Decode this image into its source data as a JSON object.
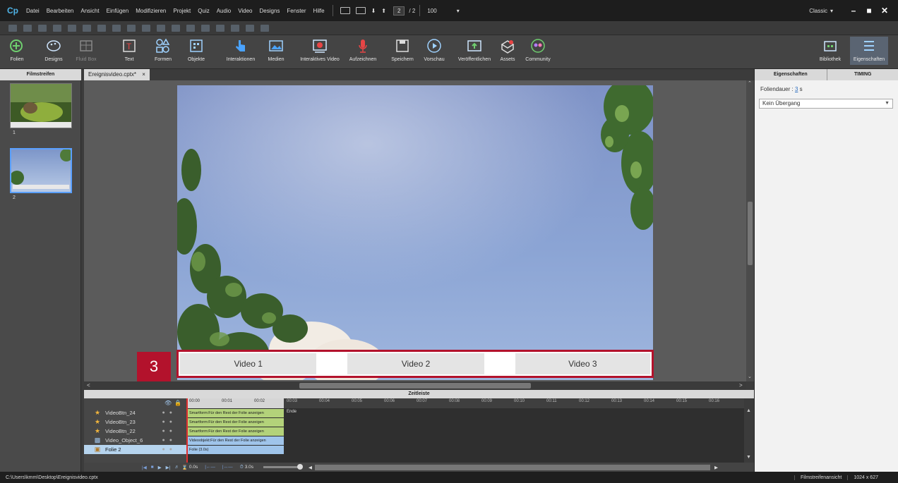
{
  "app": {
    "logo": "Cp",
    "workspace": "Classic"
  },
  "menu": [
    "Datei",
    "Bearbeiten",
    "Ansicht",
    "Einfügen",
    "Modifizieren",
    "Projekt",
    "Quiz",
    "Audio",
    "Video",
    "Designs",
    "Fenster",
    "Hilfe"
  ],
  "nav": {
    "current_page": "2",
    "total_pages": "/ 2",
    "zoom": "100"
  },
  "toolbar": {
    "tools": [
      {
        "label": "Folien",
        "icon": "plus-circle-icon"
      },
      {
        "label": "Designs",
        "icon": "palette-icon"
      },
      {
        "label": "Fluid Box",
        "icon": "fluid-box-icon"
      },
      {
        "label": "Text",
        "icon": "text-icon"
      },
      {
        "label": "Formen",
        "icon": "shapes-icon"
      },
      {
        "label": "Objekte",
        "icon": "objects-icon"
      },
      {
        "label": "Interaktionen",
        "icon": "hand-pointer-icon"
      },
      {
        "label": "Medien",
        "icon": "image-icon"
      },
      {
        "label": "Interaktives Video",
        "icon": "interactive-video-icon"
      },
      {
        "label": "Aufzeichnen",
        "icon": "microphone-icon"
      },
      {
        "label": "Speichern",
        "icon": "save-icon"
      },
      {
        "label": "Vorschau",
        "icon": "play-icon"
      },
      {
        "label": "Veröffentlichen",
        "icon": "publish-icon"
      },
      {
        "label": "Assets",
        "icon": "assets-icon"
      },
      {
        "label": "Community",
        "icon": "community-icon"
      },
      {
        "label": "Bibliothek",
        "icon": "library-icon"
      },
      {
        "label": "Eigenschaften",
        "icon": "properties-icon"
      }
    ]
  },
  "filmstrip": {
    "header": "Filmstreifen",
    "slides": [
      "1",
      "2"
    ]
  },
  "document": {
    "tab": "Ereignisvideo.cptx*",
    "close": "×"
  },
  "slide": {
    "buttons": [
      "Video 1",
      "Video 2",
      "Video 3"
    ],
    "badge": "3"
  },
  "timeline": {
    "header": "Zeitleiste",
    "rows": [
      {
        "name": "VideoBtn_24",
        "icon": "star-icon",
        "bar": "Smartform:Für den Rest der Folie anzeigen",
        "kind": "green"
      },
      {
        "name": "VideoBtn_23",
        "icon": "star-icon",
        "bar": "Smartform:Für den Rest der Folie anzeigen",
        "kind": "green"
      },
      {
        "name": "VideoBtn_22",
        "icon": "star-icon",
        "bar": "Smartform:Für den Rest der Folie anzeigen",
        "kind": "green"
      },
      {
        "name": "Video_Object_6",
        "icon": "video-object-icon",
        "bar": "Videoobjekt:Für den Rest der Folie anzeigen",
        "kind": "blue"
      },
      {
        "name": "Folie 2",
        "icon": "slide-icon",
        "bar": "Folie (3.0s)",
        "kind": "blue"
      }
    ],
    "ruler": [
      "00:00",
      "00:01",
      "00:02",
      "00:03",
      "00:04",
      "00:05",
      "00:06",
      "00:07",
      "00:08",
      "00:09",
      "00:10",
      "00:11",
      "00:12",
      "00:13",
      "00:14",
      "00:15",
      "00:16"
    ],
    "end_label": "Ende",
    "controls": {
      "time": "0.0s",
      "duration": "3.0s"
    }
  },
  "properties": {
    "tabs": [
      "Eigenschaften",
      "TIMING"
    ],
    "duration_label": "Foliendauer :",
    "duration_value": "3",
    "duration_unit": "s",
    "transition": "Kein Übergang"
  },
  "status": {
    "path": "C:\\Users\\kmm\\Desktop\\Ereignisvideo.cptx",
    "view": "Filmstreifenansicht",
    "resolution": "1024 x 627"
  }
}
